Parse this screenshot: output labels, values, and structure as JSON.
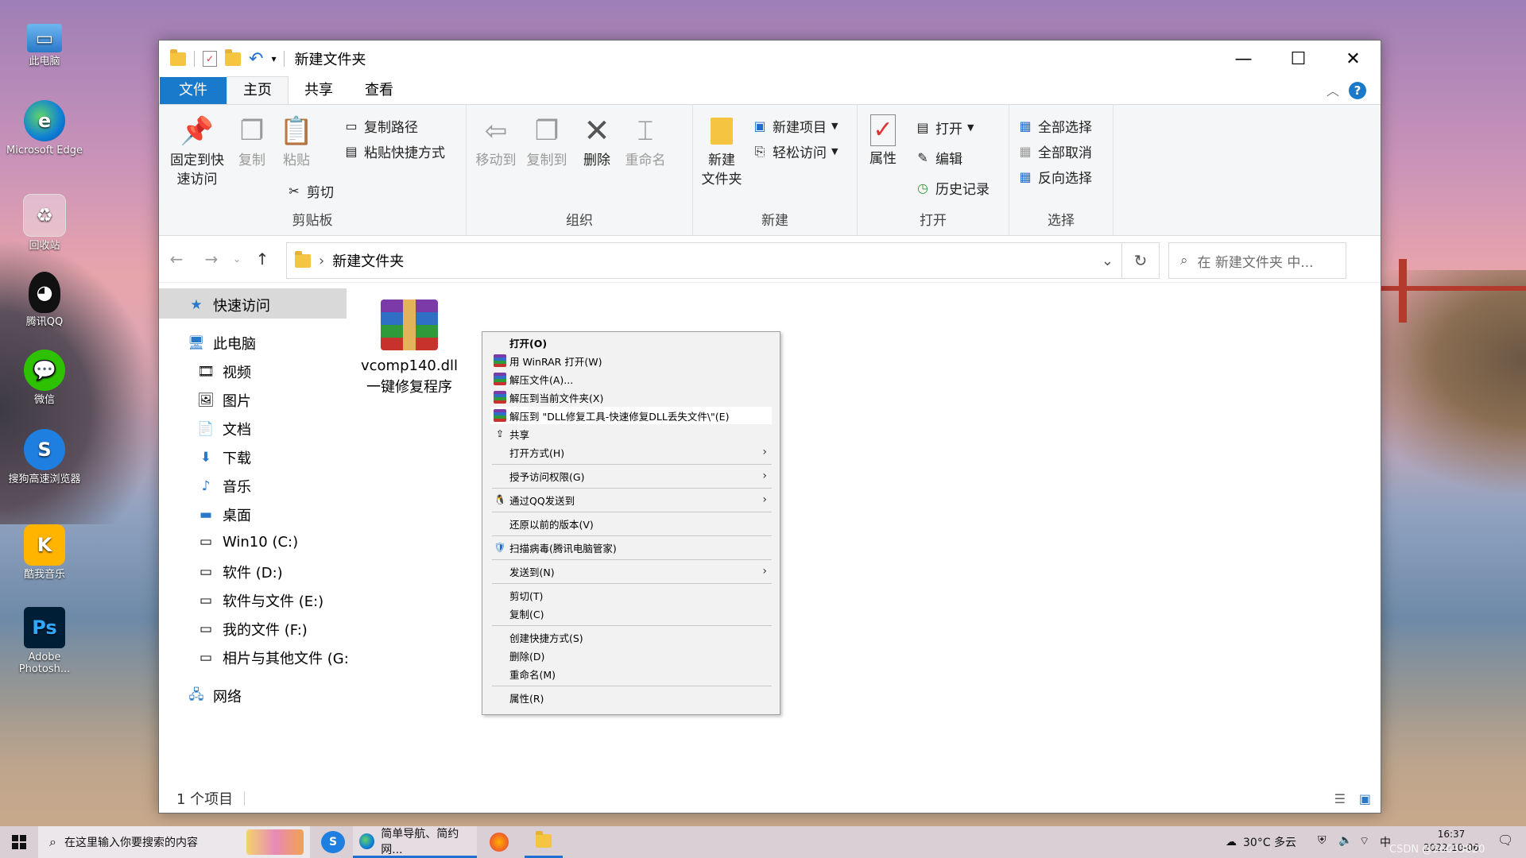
{
  "desktop": {
    "icons": [
      {
        "label": "此电脑",
        "icon": "computer-icon"
      },
      {
        "label": "Microsoft Edge",
        "icon": "edge-icon"
      },
      {
        "label": "回收站",
        "icon": "recycle-bin-icon"
      },
      {
        "label": "腾讯QQ",
        "icon": "qq-icon"
      },
      {
        "label": "微信",
        "icon": "wechat-icon"
      },
      {
        "label": "搜狗高速浏览器",
        "icon": "sogou-browser-icon"
      },
      {
        "label": "酷我音乐",
        "icon": "kuwo-music-icon"
      },
      {
        "label": "Adobe Photosh...",
        "icon": "photoshop-icon"
      }
    ]
  },
  "window": {
    "title": "新建文件夹",
    "tabs": {
      "file": "文件",
      "home": "主页",
      "share": "共享",
      "view": "查看"
    },
    "help_label": "?"
  },
  "ribbon": {
    "clipboard": {
      "pin": "固定到快\n速访问",
      "copy": "复制",
      "paste": "粘贴",
      "copy_path": "复制路径",
      "paste_shortcut": "粘贴快捷方式",
      "cut": "剪切",
      "label": "剪贴板"
    },
    "organize": {
      "move_to": "移动到",
      "copy_to": "复制到",
      "delete": "删除",
      "rename": "重命名",
      "label": "组织"
    },
    "new": {
      "new_folder": "新建\n文件夹",
      "new_item": "新建项目",
      "easy_access": "轻松访问",
      "label": "新建"
    },
    "open": {
      "properties": "属性",
      "open": "打开",
      "edit": "编辑",
      "history": "历史记录",
      "label": "打开"
    },
    "select": {
      "select_all": "全部选择",
      "select_none": "全部取消",
      "invert": "反向选择",
      "label": "选择"
    }
  },
  "address": {
    "path": "新建文件夹",
    "search_placeholder": "在 新建文件夹 中..."
  },
  "navpane": {
    "quick_access": "快速访问",
    "this_pc": "此电脑",
    "items": [
      "视频",
      "图片",
      "文档",
      "下载",
      "音乐",
      "桌面",
      "Win10 (C:)",
      "软件 (D:)",
      "软件与文件 (E:)",
      "我的文件 (F:)",
      "相片与其他文件 (G:"
    ],
    "network": "网络"
  },
  "file": {
    "name_line1": "vcomp140.dll",
    "name_line2": "一键修复程序"
  },
  "status": {
    "count": "1 个项目"
  },
  "context_menu": {
    "open": "打开(O)",
    "open_winrar": "用 WinRAR 打开(W)",
    "extract_files": "解压文件(A)...",
    "extract_here": "解压到当前文件夹(X)",
    "extract_to": "解压到 \"DLL修复工具-快速修复DLL丢失文件\\\"(E)",
    "share": "共享",
    "open_with": "打开方式(H)",
    "grant_access": "授予访问权限(G)",
    "send_qq": "通过QQ发送到",
    "restore": "还原以前的版本(V)",
    "scan": "扫描病毒(腾讯电脑管家)",
    "send_to": "发送到(N)",
    "cut": "剪切(T)",
    "copy": "复制(C)",
    "create_shortcut": "创建快捷方式(S)",
    "delete": "删除(D)",
    "rename": "重命名(M)",
    "properties": "属性(R)"
  },
  "taskbar": {
    "search_placeholder": "在这里输入你要搜索的内容",
    "browser_task": "简单导航、简约网...",
    "weather": "30°C 多云",
    "time": "16:37",
    "date": "2022-10-06",
    "watermark": "CSDN @56693820"
  }
}
